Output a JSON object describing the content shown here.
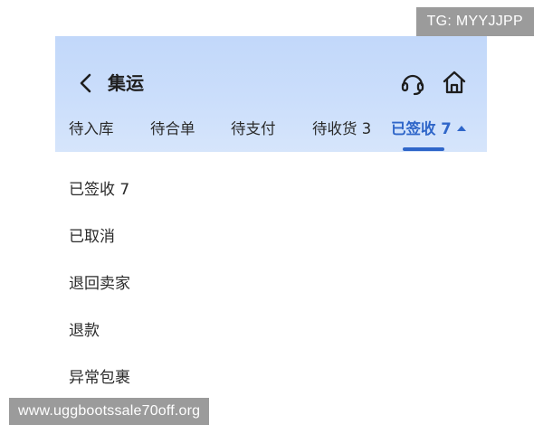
{
  "watermarks": {
    "top": "TG: MYYJJPP",
    "bottom": "www.uggbootssale70off.org"
  },
  "header": {
    "title": "集运",
    "icons": {
      "back": "chevron-left-icon",
      "service": "headset-icon",
      "home": "home-icon"
    }
  },
  "tabs": [
    {
      "label": "待入库",
      "active": false
    },
    {
      "label": "待合单",
      "active": false
    },
    {
      "label": "待支付",
      "active": false
    },
    {
      "label": "待收货 3",
      "active": false
    },
    {
      "label": "已签收 7",
      "active": true
    }
  ],
  "dropdown": {
    "items": [
      {
        "label": "已签收 7"
      },
      {
        "label": "已取消"
      },
      {
        "label": "退回卖家"
      },
      {
        "label": "退款"
      },
      {
        "label": "异常包裹"
      }
    ]
  },
  "colors": {
    "header_top": "#c2d8fa",
    "header_bottom": "#d6e5fb",
    "accent": "#2f66c9",
    "text": "#2a2a2a",
    "watermark_bg": "#9b9b9b"
  }
}
